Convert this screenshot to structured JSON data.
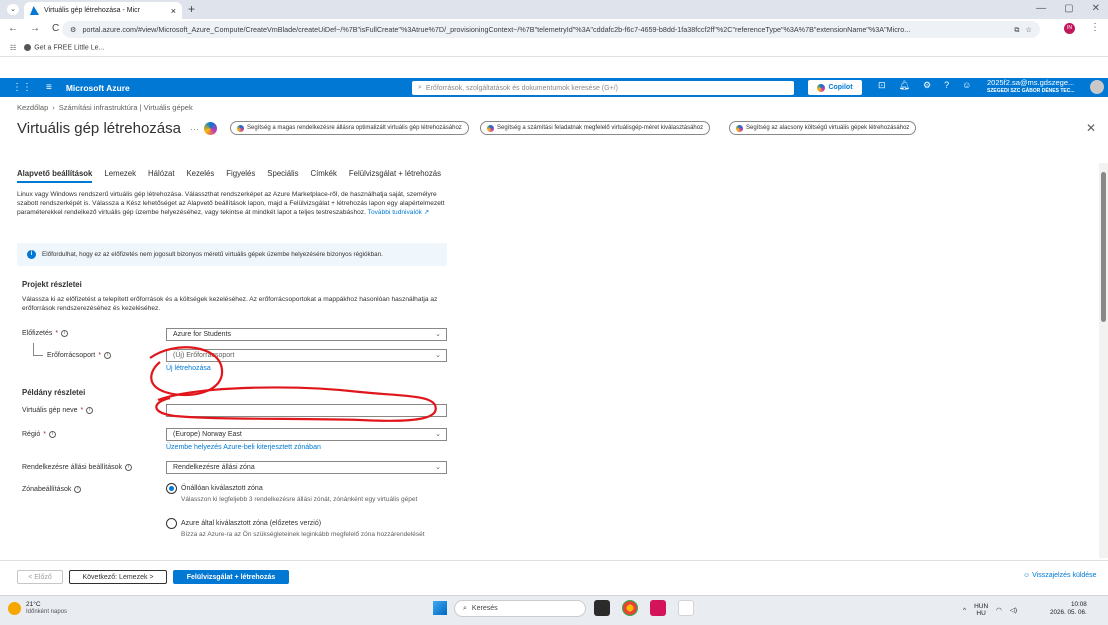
{
  "browser": {
    "tab_title": "Virtuális gép létrehozása - Micr",
    "tab_close": "×",
    "new_tab": "+",
    "tab_menu": "⌄",
    "window_controls": [
      "—",
      "▢",
      "✕"
    ],
    "nav": [
      "←",
      "→",
      "C"
    ],
    "url": "portal.azure.com/#view/Microsoft_Azure_Compute/CreateVmBlade/createUiDef~/%7B\"isFullCreate\"%3Atrue%7D/_provisioningContext~/%7B\"telemetryId\"%3A\"cddafc2b-f6c7-4659-b8dd-1fa38fccf2ff\"%2C\"referenceType\"%3A%7B\"extensionName\"%3A\"Micro...",
    "profile_initials": "IN",
    "more": "⋮",
    "bookmark": "Get a FREE Little Le..."
  },
  "azure_header": {
    "brand": "Microsoft Azure",
    "search_placeholder": "Erőforrások, szolgáltatások és dokumentumok keresése (G+/)",
    "copilot": "Copilot",
    "account_line1": "2025f2.sa@ms.gdszege...",
    "account_line2": "SZEGEDI SZC GÁBOR DÉNES TEC..."
  },
  "breadcrumb": [
    "Kezdőlap",
    "›",
    "Számítási infrastruktúra | Virtuális gépek"
  ],
  "page_title": "Virtuális gép létrehozása",
  "copilot_pills": [
    "Segítség a magas rendelkezésre állásra optimalizált virtuális gép létrehozásához",
    "Segítség a számítási feladatnak megfelelő virtuálisgép-méret kiválasztásához",
    "Segítség az alacsony költségű virtuális gépek létrehozásához"
  ],
  "close": "✕",
  "tabs": [
    "Alapvető beállítások",
    "Lemezek",
    "Hálózat",
    "Kezelés",
    "Figyelés",
    "Speciális",
    "Címkék",
    "Felülvizsgálat + létrehozás"
  ],
  "intro_text": "Linux vagy Windows rendszerű virtuális gép létrehozása. Válasszthat rendszerképet az Azure Marketplace-ről, de használhatja saját, személyre szabott rendszerképét is. Válassza a Kész lehetőséget az Alapvető beállítások lapon, majd a Felülvizsgálat + létrehozás lapon egy alapértelmezett paraméterekkel rendelkező virtuális gép üzembe helyezéséhez, vagy tekintse át mindkét lapot a teljes testreszabáshoz.",
  "intro_link": "További tudnivalók ↗",
  "info_banner": "Előfordulhat, hogy ez az előfizetés nem jogosult bizonyos méretű virtuális gépek üzembe helyezésére bizonyos régiókban.",
  "project": {
    "heading": "Projekt részletei",
    "desc": "Válassza ki az előfizetést a telepített erőforrások és a költségek kezeléséhez. Az erőforrácsoportokat a mappákhoz hasonlóan használhatja az erőforrások rendszerezéséhez és kezeléséhez.",
    "subscription_label": "Előfizetés",
    "subscription_value": "Azure for Students",
    "rg_label": "Erőforrácsoport",
    "rg_value": "(Új) Erőforrácsoport",
    "rg_new_link": "Új létrehozása"
  },
  "instance": {
    "heading": "Példány részletei",
    "vm_name_label": "Virtuális gép neve",
    "region_label": "Régió",
    "region_value": "(Europe) Norway East",
    "region_link": "Üzembe helyezés Azure-beli kiterjesztett zónában",
    "availability_label": "Rendelkezésre állási beállítások",
    "availability_value": "Rendelkezésre állási zóna",
    "zone_label": "Zónabeállítások",
    "zone_opt1_title": "Önállóan kiválasztott zóna",
    "zone_opt1_desc": "Válasszon ki legfeljebb 3 rendelkezésre állási zónát, zónánként egy virtuális gépet",
    "zone_opt2_title": "Azure által kiválasztott zóna (előzetes verzió)",
    "zone_opt2_desc": "Bízza az Azure-ra az Ön szükségleteinek leginkább megfelelő zóna hozzárendelését"
  },
  "required_mark": "*",
  "info_mark": "i",
  "chevron": "⌄",
  "footer": {
    "prev": "< Előző",
    "next": "Következő: Lemezek >",
    "review": "Felülvizsgálat + létrehozás",
    "feedback": "Visszajelzés küldése"
  },
  "taskbar": {
    "temp": "21°C",
    "weather": "Időnként napos",
    "search": "Keresés",
    "lang": "HUN",
    "lang2": "HU",
    "time": "10:08",
    "date": "2026. 05. 06."
  }
}
